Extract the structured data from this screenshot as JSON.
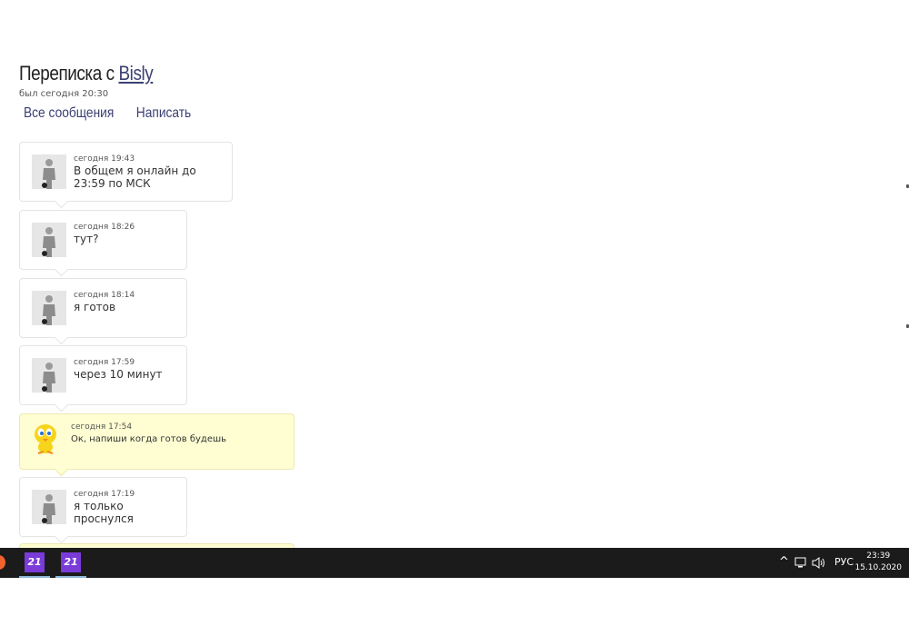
{
  "header": {
    "title_prefix": "Переписка с",
    "title_user": "Bisly",
    "last_seen": "был сегодня 20:30"
  },
  "nav": {
    "all_messages": "Все сообщения",
    "write": "Написать"
  },
  "messages": [
    {
      "time": "сегодня 19:43",
      "text": "В общем я онлайн до 23:59 по МСК",
      "author": "Bisly",
      "avatar": "silhouette-avatar"
    },
    {
      "time": "сегодня 18:26",
      "text": "тут?",
      "author": "Bisly",
      "avatar": "silhouette-avatar"
    },
    {
      "time": "сегодня 18:14",
      "text": "я готов",
      "author": "Bisly",
      "avatar": "silhouette-avatar"
    },
    {
      "time": "сегодня 17:59",
      "text": "через 10 минут",
      "author": "Bisly",
      "avatar": "silhouette-avatar"
    },
    {
      "time": "сегодня 17:54",
      "text": "Ок, напиши когда готов будешь",
      "author": "me",
      "avatar": "bird-avatar"
    },
    {
      "time": "сегодня 17:19",
      "text": "я только проснулся",
      "author": "Bisly",
      "avatar": "silhouette-avatar"
    }
  ],
  "taskbar": {
    "apps": [
      {
        "label": "21"
      },
      {
        "label": "21"
      }
    ],
    "tray_chevron": "^",
    "language": "РУС",
    "time": "23:39",
    "date": "15.10.2020"
  },
  "colors": {
    "link": "#3b3f72",
    "my_message_bg": "#fefed2",
    "app_icon": "#7b3bd8",
    "taskbar": "#1b1b1b"
  }
}
